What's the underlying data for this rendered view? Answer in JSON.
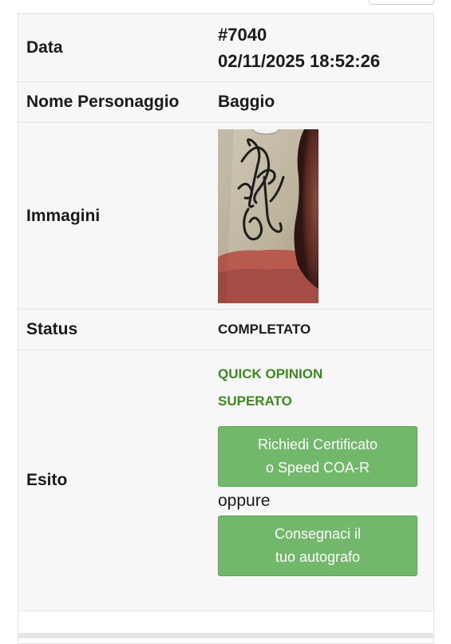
{
  "rows": {
    "data": {
      "label": "Data",
      "id": "#7040",
      "datetime": "02/11/2025 18:52:26"
    },
    "nome": {
      "label": "Nome Personaggio",
      "value": "Baggio"
    },
    "immagini": {
      "label": "Immagini",
      "image": "autograph-photo"
    },
    "status": {
      "label": "Status",
      "value": "COMPLETATO"
    },
    "esito": {
      "label": "Esito",
      "result_line1": "QUICK OPINION",
      "result_line2": "SUPERATO",
      "button1_line1": "Richiedi Certificato",
      "button1_line2": "o Speed COA-R",
      "oppure": "oppure",
      "button2_line1": "Consegnaci il",
      "button2_line2": "tuo autografo"
    }
  },
  "colors": {
    "success_green": "#3a8a1f",
    "button_green": "#71b86a"
  }
}
